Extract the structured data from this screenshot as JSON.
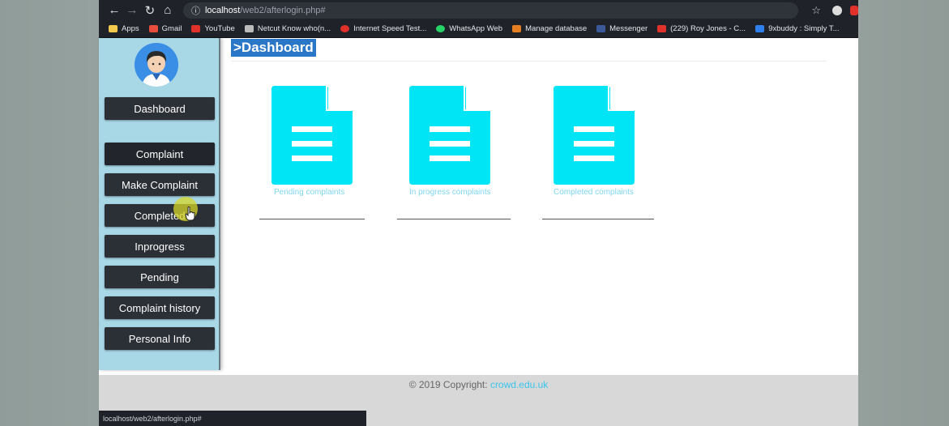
{
  "browser": {
    "url_host": "localhost",
    "url_path": "/web2/afterlogin.php#",
    "bookmarks": [
      {
        "label": "Apps",
        "color": "#f2c94c"
      },
      {
        "label": "Gmail",
        "color": "#e74c3c"
      },
      {
        "label": "YouTube",
        "color": "#e0322b"
      },
      {
        "label": "Netcut Know who(n...",
        "color": "#bbbbbb"
      },
      {
        "label": "Internet Speed Test...",
        "color": "#e0322b"
      },
      {
        "label": "WhatsApp Web",
        "color": "#25d366"
      },
      {
        "label": "Manage database",
        "color": "#e67e22"
      },
      {
        "label": "Messenger",
        "color": "#3b5998"
      },
      {
        "label": "(229) Roy Jones - C...",
        "color": "#e0322b"
      },
      {
        "label": "9xbuddy : Simply T...",
        "color": "#2f80ed"
      }
    ],
    "status_text": "localhost/web2/afterlogin.php#"
  },
  "sidebar": {
    "items": [
      {
        "label": "Dashboard"
      },
      {
        "label": "Complaint"
      },
      {
        "label": "Make Complaint"
      },
      {
        "label": "Completed"
      },
      {
        "label": "Inprogress"
      },
      {
        "label": "Pending"
      },
      {
        "label": "Complaint history"
      },
      {
        "label": "Personal Info"
      }
    ]
  },
  "main": {
    "title": ">Dashboard",
    "cards": [
      {
        "caption": "Pending complaints",
        "icon": "document-icon"
      },
      {
        "caption": "In progress complaints",
        "icon": "document-icon"
      },
      {
        "caption": "Completed complaints",
        "icon": "document-icon"
      }
    ]
  },
  "footer": {
    "copyright": "© 2019 Copyright:",
    "link_text": "crowd.edu.uk"
  },
  "colors": {
    "accent": "#00e5f5",
    "sidebar_bg": "#a8d7e6",
    "button_bg": "#2b2f36",
    "title_highlight": "#2a76c7"
  }
}
